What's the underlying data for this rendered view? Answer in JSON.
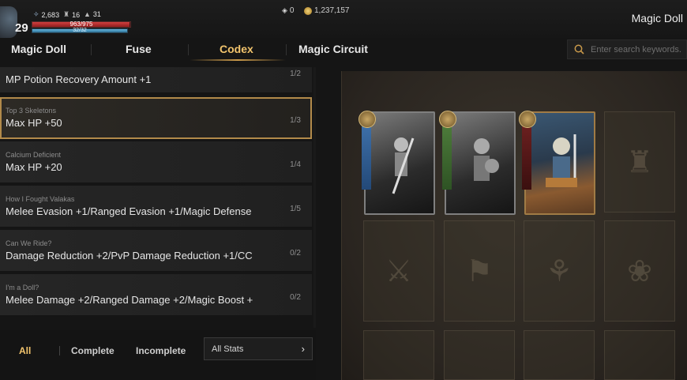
{
  "player": {
    "level": "29",
    "stat_a": "2,683",
    "stat_b": "16",
    "stat_c": "31",
    "hp_text": "963/975",
    "hp_fraction": 0.99,
    "mp_text": "32/32",
    "mp_fraction": 1.0
  },
  "currency": {
    "gems": "0",
    "gold": "1,237,157"
  },
  "window_title": "Magic Doll",
  "tabs": [
    {
      "label": "Magic Doll"
    },
    {
      "label": "Fuse"
    },
    {
      "label": "Codex"
    },
    {
      "label": "Magic Circuit"
    }
  ],
  "active_tab": "Codex",
  "search": {
    "placeholder": "Enter search keywords."
  },
  "codex_list": [
    {
      "name": "",
      "effect": "MP Potion Recovery Amount +1",
      "progress": "1/2"
    },
    {
      "name": "Top 3 Skeletons",
      "effect": "Max HP +50",
      "progress": "1/3"
    },
    {
      "name": "Calcium Deficient",
      "effect": "Max HP +20",
      "progress": "1/4"
    },
    {
      "name": "How I Fought Valakas",
      "effect": "Melee Evasion +1/Ranged Evasion +1/Magic Defense",
      "progress": "1/5"
    },
    {
      "name": "Can We Ride?",
      "effect": "Damage Reduction +2/PvP Damage Reduction +1/CC",
      "progress": "0/2"
    },
    {
      "name": "I'm a Doll?",
      "effect": "Melee Damage +2/Ranged Damage +2/Magic Boost +",
      "progress": "0/2"
    }
  ],
  "filters": {
    "all": "All",
    "complete": "Complete",
    "incomplete": "Incomplete",
    "stat_select": "All Stats"
  },
  "colors": {
    "accent_gold": "#f2c46d",
    "hp_red": "#d24040",
    "mp_blue": "#66b6de"
  }
}
